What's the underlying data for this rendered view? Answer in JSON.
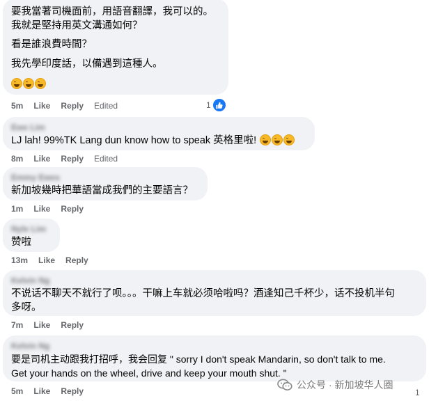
{
  "comments": [
    {
      "lines": [
        "要我當著司機面前，用語音翻譯，我可以的。",
        "我就是堅持用英文溝通如何？",
        "看是誰浪費時間？",
        "我先學印度話，以備遇到這種人。"
      ],
      "time": "5m",
      "like": "Like",
      "reply": "Reply",
      "edited": "Edited",
      "reaction_count": "1"
    },
    {
      "author": "Ewe Lim",
      "text": "LJ lah! 99%TK Lang dun know how to speak 英格里啦!",
      "time": "8m",
      "like": "Like",
      "reply": "Reply",
      "edited": "Edited"
    },
    {
      "author": "Emmy Ewes",
      "text": "新加坡幾時把華語當成我們的主要語言？",
      "time": "1m",
      "like": "Like",
      "reply": "Reply"
    },
    {
      "author": "Nyle Lim",
      "text": "赞啦",
      "time": "13m",
      "like": "Like",
      "reply": "Reply"
    },
    {
      "author": "Kelvin Ng",
      "lines": [
        "不说话不聊天不就行了呗。。。干嘛上车就必须哈啦吗？酒逢知己千杯少，话不投机半句",
        "多呀。"
      ],
      "time": "7m",
      "like": "Like",
      "reply": "Reply"
    },
    {
      "author": "Kelvin Ng",
      "lines": [
        "要是司机主动跟我打招呼，我会回复 \" sorry I don't speak Mandarin, so don't talk to me.",
        "Get your hands on the wheel, drive and keep your mouth shut. \""
      ],
      "time": "5m",
      "like": "Like",
      "reply": "Reply",
      "reaction_count": "1"
    }
  ],
  "watermark": "公众号 · 新加坡华人圈",
  "icons": {
    "reaction": "like-icon",
    "emoji": "laughing-emoji-icon",
    "watermark": "wechat-icon"
  },
  "colors": {
    "bubble": "#f0f2f5",
    "meta": "#65676b",
    "like_blue": "#1877f2"
  }
}
